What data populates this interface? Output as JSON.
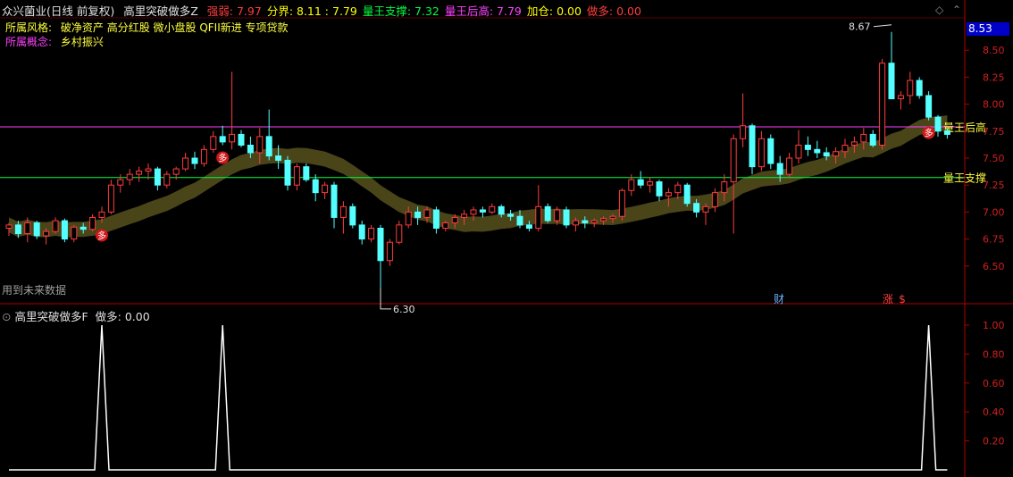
{
  "header": {
    "stock": "众兴菌业(日线 前复权)",
    "indicator": "高里突破做多Z",
    "items": [
      {
        "label": "强弱: 7.97",
        "color": "#ff3c3c"
      },
      {
        "label": "分界: 8.11 : 7.79",
        "color": "#ffff00"
      },
      {
        "label": "量王支撑: 7.32",
        "color": "#00ff40"
      },
      {
        "label": "量王后高: 7.79",
        "color": "#ff40ff"
      },
      {
        "label": "加仓: 0.00",
        "color": "#ffff00"
      },
      {
        "label": "做多: 0.00",
        "color": "#ff3c3c"
      }
    ]
  },
  "style_row": {
    "label": "所属风格:",
    "value": "破净资产 高分红股 微小盘股 QFII新进 专项贷款"
  },
  "concept_row": {
    "label": "所属概念:",
    "value": "乡村振兴"
  },
  "future_note": "用到未来数据",
  "sub_header": {
    "indicator": "高里突破做多F",
    "value": "做多: 0.00"
  },
  "current_price": "8.53",
  "chart_data": [
    {
      "type": "candlestick",
      "y_axis_ticks": [
        8.5,
        8.25,
        8.0,
        7.75,
        7.5,
        7.25,
        7.0,
        6.75,
        6.5
      ],
      "ylim": [
        6.2,
        8.8
      ],
      "hlines": [
        {
          "value": 7.79,
          "label": "量王后高",
          "color": "#ff40ff"
        },
        {
          "value": 7.32,
          "label": "量王支撑",
          "color": "#00ff40"
        }
      ],
      "annotations": {
        "high": "8.67",
        "low": "6.30",
        "signals": [
          "多",
          "多",
          "多"
        ],
        "markers": [
          "财",
          "涨",
          "$"
        ]
      },
      "bars": [
        [
          6.85,
          6.9,
          6.78,
          6.88
        ],
        [
          6.88,
          6.92,
          6.76,
          6.8
        ],
        [
          6.8,
          6.95,
          6.72,
          6.9
        ],
        [
          6.9,
          6.92,
          6.75,
          6.78
        ],
        [
          6.78,
          6.85,
          6.7,
          6.82
        ],
        [
          6.82,
          6.95,
          6.8,
          6.92
        ],
        [
          6.92,
          6.94,
          6.72,
          6.75
        ],
        [
          6.75,
          6.88,
          6.72,
          6.86
        ],
        [
          6.86,
          6.9,
          6.8,
          6.84
        ],
        [
          6.84,
          6.98,
          6.82,
          6.95
        ],
        [
          6.95,
          7.05,
          6.9,
          7.0
        ],
        [
          7.0,
          7.3,
          6.98,
          7.25
        ],
        [
          7.25,
          7.35,
          7.18,
          7.3
        ],
        [
          7.3,
          7.4,
          7.25,
          7.35
        ],
        [
          7.35,
          7.42,
          7.28,
          7.38
        ],
        [
          7.38,
          7.45,
          7.3,
          7.4
        ],
        [
          7.4,
          7.42,
          7.2,
          7.25
        ],
        [
          7.25,
          7.38,
          7.22,
          7.35
        ],
        [
          7.35,
          7.42,
          7.3,
          7.4
        ],
        [
          7.4,
          7.55,
          7.38,
          7.5
        ],
        [
          7.5,
          7.56,
          7.4,
          7.45
        ],
        [
          7.45,
          7.62,
          7.42,
          7.58
        ],
        [
          7.58,
          7.75,
          7.55,
          7.7
        ],
        [
          7.7,
          7.8,
          7.62,
          7.65
        ],
        [
          7.65,
          8.3,
          7.58,
          7.72
        ],
        [
          7.72,
          7.76,
          7.6,
          7.62
        ],
        [
          7.62,
          7.7,
          7.5,
          7.55
        ],
        [
          7.55,
          7.78,
          7.45,
          7.7
        ],
        [
          7.7,
          7.95,
          7.48,
          7.52
        ],
        [
          7.52,
          7.62,
          7.4,
          7.48
        ],
        [
          7.48,
          7.52,
          7.2,
          7.25
        ],
        [
          7.25,
          7.45,
          7.2,
          7.42
        ],
        [
          7.42,
          7.45,
          7.28,
          7.3
        ],
        [
          7.3,
          7.35,
          7.1,
          7.18
        ],
        [
          7.18,
          7.28,
          7.12,
          7.25
        ],
        [
          7.25,
          7.28,
          6.85,
          6.95
        ],
        [
          6.95,
          7.1,
          6.8,
          7.05
        ],
        [
          7.05,
          7.08,
          6.85,
          6.88
        ],
        [
          6.88,
          6.92,
          6.7,
          6.75
        ],
        [
          6.75,
          6.88,
          6.72,
          6.85
        ],
        [
          6.85,
          6.88,
          6.3,
          6.55
        ],
        [
          6.55,
          6.75,
          6.5,
          6.72
        ],
        [
          6.72,
          6.92,
          6.7,
          6.88
        ],
        [
          6.88,
          7.05,
          6.85,
          7.0
        ],
        [
          7.0,
          7.05,
          6.88,
          6.95
        ],
        [
          6.95,
          7.05,
          6.9,
          7.02
        ],
        [
          7.02,
          7.05,
          6.8,
          6.85
        ],
        [
          6.85,
          6.92,
          6.82,
          6.9
        ],
        [
          6.9,
          6.98,
          6.85,
          6.95
        ],
        [
          6.95,
          7.02,
          6.88,
          6.98
        ],
        [
          6.98,
          7.05,
          6.92,
          7.02
        ],
        [
          7.02,
          7.05,
          6.95,
          7.0
        ],
        [
          7.0,
          7.08,
          6.98,
          7.05
        ],
        [
          7.05,
          7.07,
          6.95,
          6.98
        ],
        [
          6.98,
          7.02,
          6.92,
          6.96
        ],
        [
          6.96,
          7.02,
          6.85,
          6.88
        ],
        [
          6.88,
          6.92,
          6.82,
          6.85
        ],
        [
          6.85,
          7.25,
          6.82,
          7.05
        ],
        [
          7.05,
          7.08,
          6.9,
          6.92
        ],
        [
          6.92,
          7.05,
          6.88,
          7.02
        ],
        [
          7.02,
          7.05,
          6.85,
          6.88
        ],
        [
          6.88,
          6.95,
          6.82,
          6.92
        ],
        [
          6.92,
          6.96,
          6.85,
          6.9
        ],
        [
          6.9,
          6.94,
          6.86,
          6.92
        ],
        [
          6.92,
          6.96,
          6.88,
          6.94
        ],
        [
          6.94,
          6.98,
          6.9,
          6.96
        ],
        [
          6.96,
          7.22,
          6.92,
          7.2
        ],
        [
          7.2,
          7.35,
          7.15,
          7.3
        ],
        [
          7.3,
          7.38,
          7.22,
          7.25
        ],
        [
          7.25,
          7.32,
          7.18,
          7.28
        ],
        [
          7.28,
          7.3,
          7.1,
          7.15
        ],
        [
          7.15,
          7.22,
          7.05,
          7.18
        ],
        [
          7.18,
          7.28,
          7.12,
          7.25
        ],
        [
          7.25,
          7.27,
          7.05,
          7.08
        ],
        [
          7.08,
          7.12,
          6.95,
          7.0
        ],
        [
          7.0,
          7.08,
          6.88,
          7.05
        ],
        [
          7.05,
          7.22,
          7.0,
          7.18
        ],
        [
          7.18,
          7.35,
          7.1,
          7.28
        ],
        [
          7.28,
          7.72,
          6.8,
          7.68
        ],
        [
          7.68,
          8.1,
          7.6,
          7.8
        ],
        [
          7.8,
          7.82,
          7.35,
          7.42
        ],
        [
          7.42,
          7.75,
          7.38,
          7.68
        ],
        [
          7.68,
          7.72,
          7.4,
          7.45
        ],
        [
          7.45,
          7.52,
          7.28,
          7.35
        ],
        [
          7.35,
          7.55,
          7.32,
          7.5
        ],
        [
          7.5,
          7.76,
          7.45,
          7.62
        ],
        [
          7.62,
          7.7,
          7.52,
          7.58
        ],
        [
          7.58,
          7.66,
          7.5,
          7.55
        ],
        [
          7.55,
          7.6,
          7.48,
          7.52
        ],
        [
          7.52,
          7.6,
          7.45,
          7.56
        ],
        [
          7.56,
          7.68,
          7.5,
          7.62
        ],
        [
          7.62,
          7.7,
          7.55,
          7.65
        ],
        [
          7.65,
          7.78,
          7.58,
          7.72
        ],
        [
          7.72,
          7.76,
          7.6,
          7.62
        ],
        [
          7.62,
          8.42,
          7.58,
          8.38
        ],
        [
          8.38,
          8.67,
          8.2,
          8.05
        ],
        [
          8.05,
          8.12,
          7.95,
          8.08
        ],
        [
          8.08,
          8.3,
          8.0,
          8.22
        ],
        [
          8.22,
          8.25,
          8.05,
          8.08
        ],
        [
          8.08,
          8.12,
          7.85,
          7.88
        ],
        [
          7.88,
          7.9,
          7.7,
          7.75
        ],
        [
          7.75,
          7.78,
          7.68,
          7.72
        ]
      ]
    },
    {
      "type": "line",
      "y_axis_ticks": [
        1.0,
        0.8,
        0.6,
        0.4,
        0.2
      ],
      "ylim": [
        0,
        1.05
      ],
      "series": [
        {
          "name": "做多",
          "spikes_at_bar": [
            10,
            23,
            99
          ]
        }
      ]
    }
  ]
}
